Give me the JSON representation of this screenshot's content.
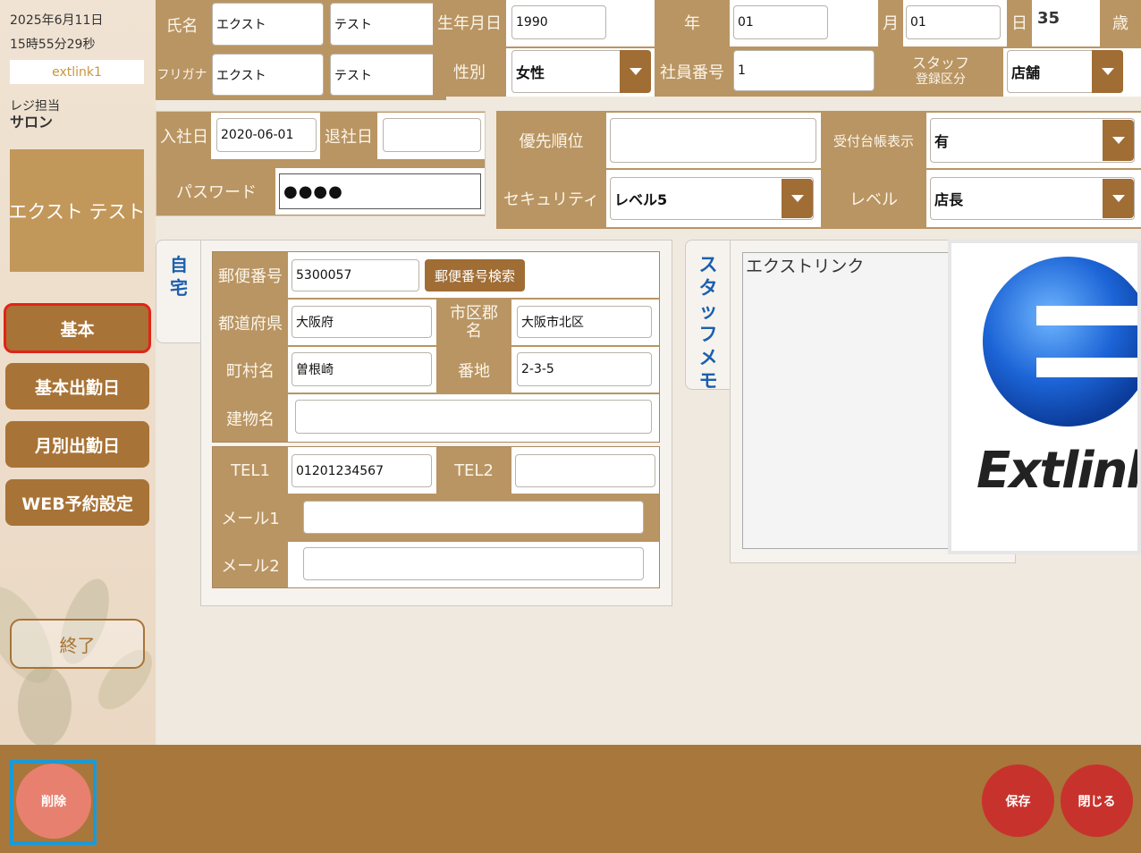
{
  "sidebar": {
    "date": "2025年6月11日",
    "time": "15時55分29秒",
    "store": "extlink1",
    "register_role": "レジ担当",
    "register_name": "サロン",
    "staff_name": "エクスト テスト",
    "nav": [
      "基本",
      "基本出勤日",
      "月別出勤日",
      "WEB予約設定"
    ],
    "exit_label": "終了"
  },
  "header": {
    "name_label": "氏名",
    "last_name": "エクスト",
    "first_name": "テスト",
    "kana_label": "フリガナ",
    "kana_last": "エクスト",
    "kana_first": "テスト",
    "birth_label": "生年月日",
    "birth_year": "1990",
    "year_label": "年",
    "birth_month": "01",
    "month_label": "月",
    "birth_day": "01",
    "day_label": "日",
    "age": "35",
    "age_label": "歳",
    "gender_label": "性別",
    "gender": "女性",
    "employee_no_label": "社員番号",
    "employee_no": "1",
    "staff_reg_label_1": "スタッフ",
    "staff_reg_label_2": "登録区分",
    "staff_reg_value": "店舗"
  },
  "employment": {
    "join_label": "入社日",
    "join_date": "2020-06-01",
    "leave_label": "退社日",
    "leave_date": "",
    "password_label": "パスワード",
    "password_mask": "●●●●"
  },
  "settings": {
    "priority_label": "優先順位",
    "priority_value": "",
    "ledger_label": "受付台帳表示",
    "ledger_value": "有",
    "security_label": "セキュリティ",
    "security_value": "レベル5",
    "level_label": "レベル",
    "level_value": "店長"
  },
  "home_tab": {
    "label_1": "自",
    "label_2": "宅"
  },
  "address": {
    "postal_label": "郵便番号",
    "postal_code": "5300057",
    "postal_search": "郵便番号検索",
    "pref_label": "都道府県",
    "pref": "大阪府",
    "city_label_1": "市区郡",
    "city_label_2": "名",
    "city": "大阪市北区",
    "town_label": "町村名",
    "town": "曽根崎",
    "banchi_label": "番地",
    "banchi": "2-3-5",
    "building_label": "建物名",
    "building": "",
    "tel1_label": "TEL1",
    "tel1": "01201234567",
    "tel2_label": "TEL2",
    "tel2": "",
    "mail1_label": "メール1",
    "mail1": "",
    "mail2_label": "メール2",
    "mail2": ""
  },
  "memo": {
    "tab_label": [
      "ス",
      "タ",
      "ッ",
      "フ",
      "メ",
      "モ"
    ],
    "text": "エクストリンク"
  },
  "photo": {
    "logo_text": "Extlink"
  },
  "footer": {
    "delete": "削除",
    "save": "保存",
    "close": "閉じる"
  },
  "colors": {
    "label_bg": "#b99563",
    "button_brown": "#a87336",
    "footer_bg": "#a8773b",
    "delete_btn": "#e8806f",
    "save_btn": "#c8322c",
    "selected_outline": "#e2231a",
    "focus_outline": "#1a9ad6"
  }
}
